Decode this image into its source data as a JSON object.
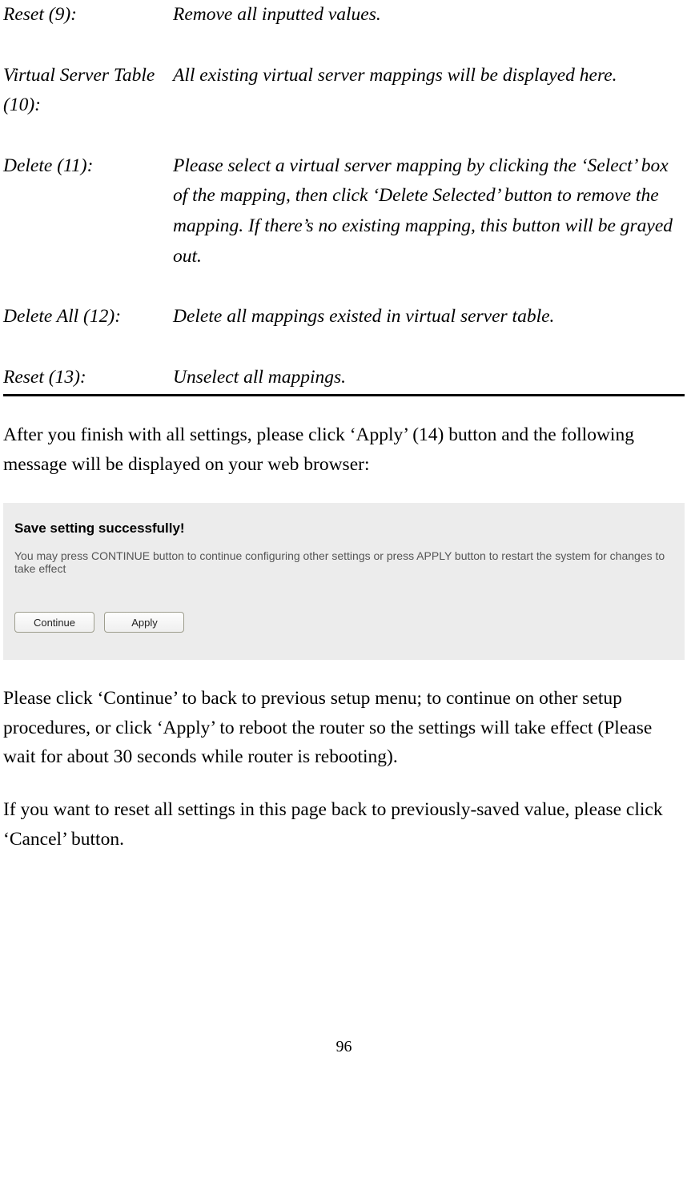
{
  "definitions": [
    {
      "label": "Reset (9):",
      "desc": "Remove all inputted values."
    },
    {
      "label": "Virtual Server Table (10):",
      "desc": "All existing virtual server mappings will be displayed here."
    },
    {
      "label": "Delete (11):",
      "desc": "Please select a virtual server mapping by clicking the ‘Select’ box of the mapping, then click ‘Delete Selected’ button to remove the mapping. If there’s no existing mapping, this button will be grayed out."
    },
    {
      "label": "Delete All (12):",
      "desc": "Delete all mappings existed in virtual server table."
    },
    {
      "label": "Reset (13):",
      "desc": "Unselect all mappings."
    }
  ],
  "paragraph_after_table": "After you finish with all settings, please click ‘Apply’ (14) button and the following message will be displayed on your web browser:",
  "panel": {
    "title": "Save setting successfully!",
    "message": "You may press CONTINUE button to continue configuring other settings or press APPLY button to restart the system for changes to take effect",
    "continue_label": "Continue",
    "apply_label": "Apply"
  },
  "paragraph_below_panel_1": "Please click ‘Continue’ to back to previous setup menu; to continue on other setup procedures, or click ‘Apply’ to reboot the router so the settings will take effect (Please wait for about 30 seconds while router is rebooting).",
  "paragraph_below_panel_2": "If you want to reset all settings in this page back to previously-saved value, please click ‘Cancel’ button.",
  "page_number": "96"
}
